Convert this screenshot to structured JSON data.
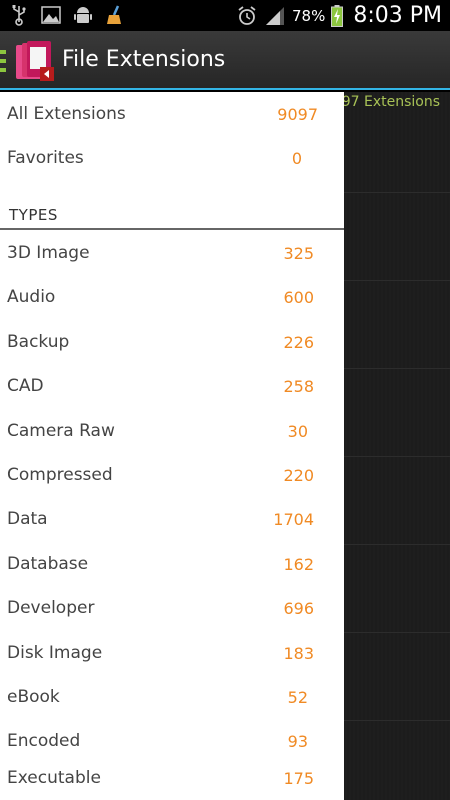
{
  "status_bar": {
    "icons": [
      "usb-icon",
      "gallery-icon",
      "android-debug-icon",
      "cleaner-icon"
    ],
    "battery_percent": "78%",
    "time": "8:03 PM"
  },
  "action_bar": {
    "title": "File Extensions"
  },
  "background": {
    "count_text": "97 Extensions"
  },
  "drawer": {
    "top_items": [
      {
        "label": "All Extensions",
        "count": "9097"
      },
      {
        "label": "Favorites",
        "count": "0"
      }
    ],
    "section_title": "TYPES",
    "types": [
      {
        "label": "3D Image",
        "count": "325"
      },
      {
        "label": "Audio",
        "count": "600"
      },
      {
        "label": "Backup",
        "count": "226"
      },
      {
        "label": "CAD",
        "count": "258"
      },
      {
        "label": "Camera Raw",
        "count": "30"
      },
      {
        "label": "Compressed",
        "count": "220"
      },
      {
        "label": "Data",
        "count": "1704"
      },
      {
        "label": "Database",
        "count": "162"
      },
      {
        "label": "Developer",
        "count": "696"
      },
      {
        "label": "Disk Image",
        "count": "183"
      },
      {
        "label": "eBook",
        "count": "52"
      },
      {
        "label": "Encoded",
        "count": "93"
      },
      {
        "label": "Executable",
        "count": "175"
      }
    ]
  },
  "colors": {
    "accent_blue": "#33b5e5",
    "count_orange": "#f08a24",
    "drawer_indicator_green": "#8cc63f"
  }
}
